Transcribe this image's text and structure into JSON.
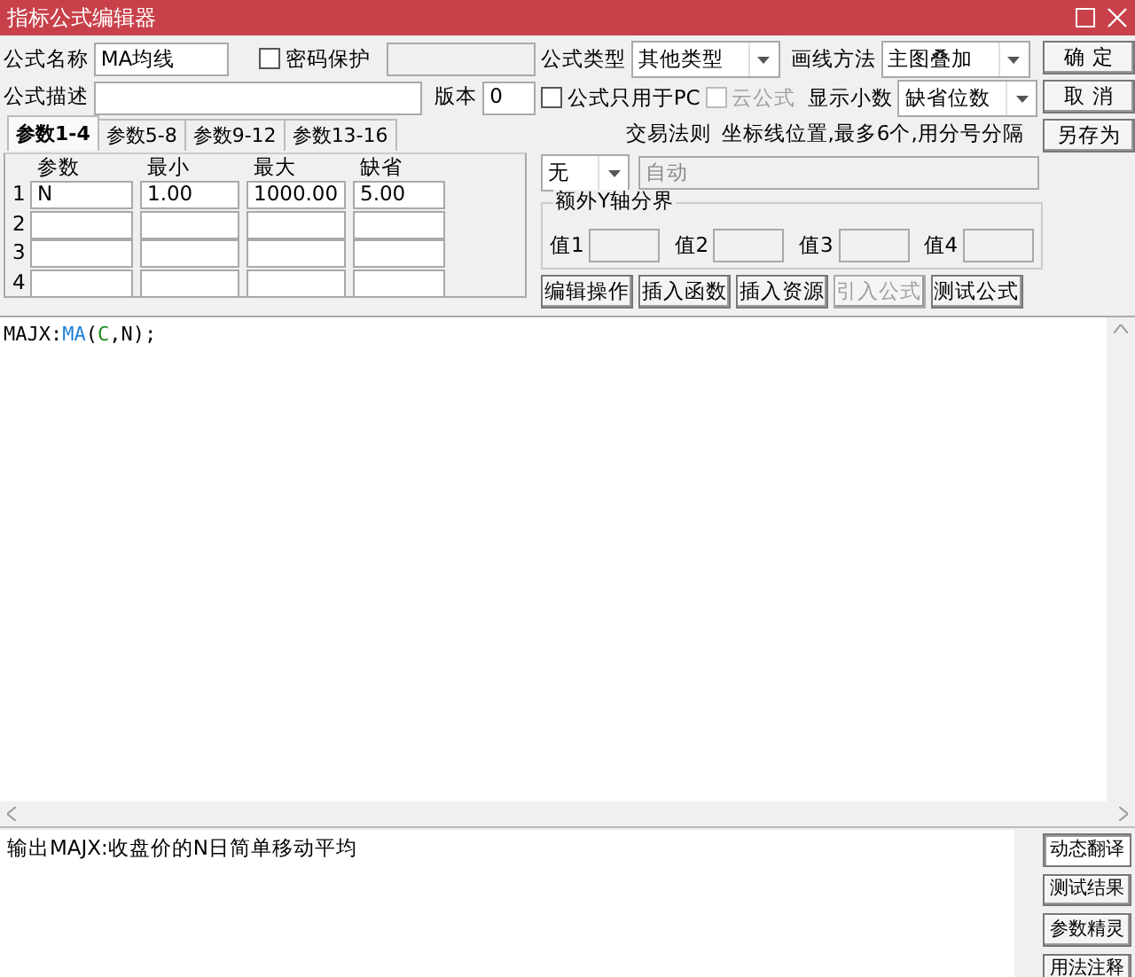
{
  "window": {
    "title": "指标公式编辑器"
  },
  "formula_name": {
    "label": "公式名称",
    "value": "MA均线"
  },
  "password_protect": {
    "label": "密码保护",
    "checked": false
  },
  "formula_desc": {
    "label": "公式描述"
  },
  "version": {
    "label": "版本",
    "value": "0"
  },
  "formula_type": {
    "label": "公式类型",
    "value": "其他类型"
  },
  "draw_method": {
    "label": "画线方法",
    "value": "主图叠加"
  },
  "pc_only": {
    "label": "公式只用于PC",
    "checked": false,
    "disabled": false
  },
  "cloud_formula": {
    "label": "云公式",
    "checked": false,
    "disabled": true
  },
  "decimals": {
    "label": "显示小数",
    "value": "缺省位数"
  },
  "side_buttons": [
    {
      "label": "确 定"
    },
    {
      "label": "取 消"
    },
    {
      "label": "另存为"
    }
  ],
  "param_tabs": [
    {
      "label": "参数1-4",
      "selected": true
    },
    {
      "label": "参数5-8",
      "selected": false
    },
    {
      "label": "参数9-12",
      "selected": false
    },
    {
      "label": "参数13-16",
      "selected": false
    }
  ],
  "param_table": {
    "columns": [
      "参数",
      "最小",
      "最大",
      "缺省"
    ],
    "rows": [
      {
        "index": "1",
        "cells": [
          "N",
          "1.00",
          "1000.00",
          "5.00"
        ]
      },
      {
        "index": "2"
      },
      {
        "index": "3"
      },
      {
        "index": "4"
      }
    ]
  },
  "trade_rule": {
    "label": "交易法则",
    "value": "无"
  },
  "axis_lines": {
    "label": "坐标线位置,最多6个,用分号分隔",
    "value": "自动",
    "disabled": true
  },
  "y_axis_group": {
    "title": "额外Y轴分界",
    "values": [
      {
        "label": "值1",
        "disabled": true
      },
      {
        "label": "值2",
        "disabled": true
      },
      {
        "label": "值3",
        "disabled": true
      },
      {
        "label": "值4",
        "disabled": true
      }
    ]
  },
  "tool_buttons": [
    {
      "label": "编辑操作",
      "disabled": false
    },
    {
      "label": "插入函数",
      "disabled": false
    },
    {
      "label": "插入资源",
      "disabled": false
    },
    {
      "label": "引入公式",
      "disabled": true
    },
    {
      "label": "测试公式",
      "disabled": false
    }
  ],
  "editor": {
    "lines": [
      [
        {
          "text": "MAJX:",
          "kind": "plain"
        },
        {
          "text": "MA",
          "kind": "function"
        },
        {
          "text": "(",
          "kind": "plain"
        },
        {
          "text": "C",
          "kind": "variable"
        },
        {
          "text": ",N);",
          "kind": "plain"
        }
      ]
    ]
  },
  "output": {
    "text": "输出MAJX:收盘价的N日简单移动平均"
  },
  "output_tabs": [
    {
      "label": "动态翻译",
      "selected": true
    },
    {
      "label": "测试结果",
      "selected": false
    },
    {
      "label": "参数精灵",
      "selected": false
    },
    {
      "label": "用法注释",
      "selected": false
    }
  ]
}
